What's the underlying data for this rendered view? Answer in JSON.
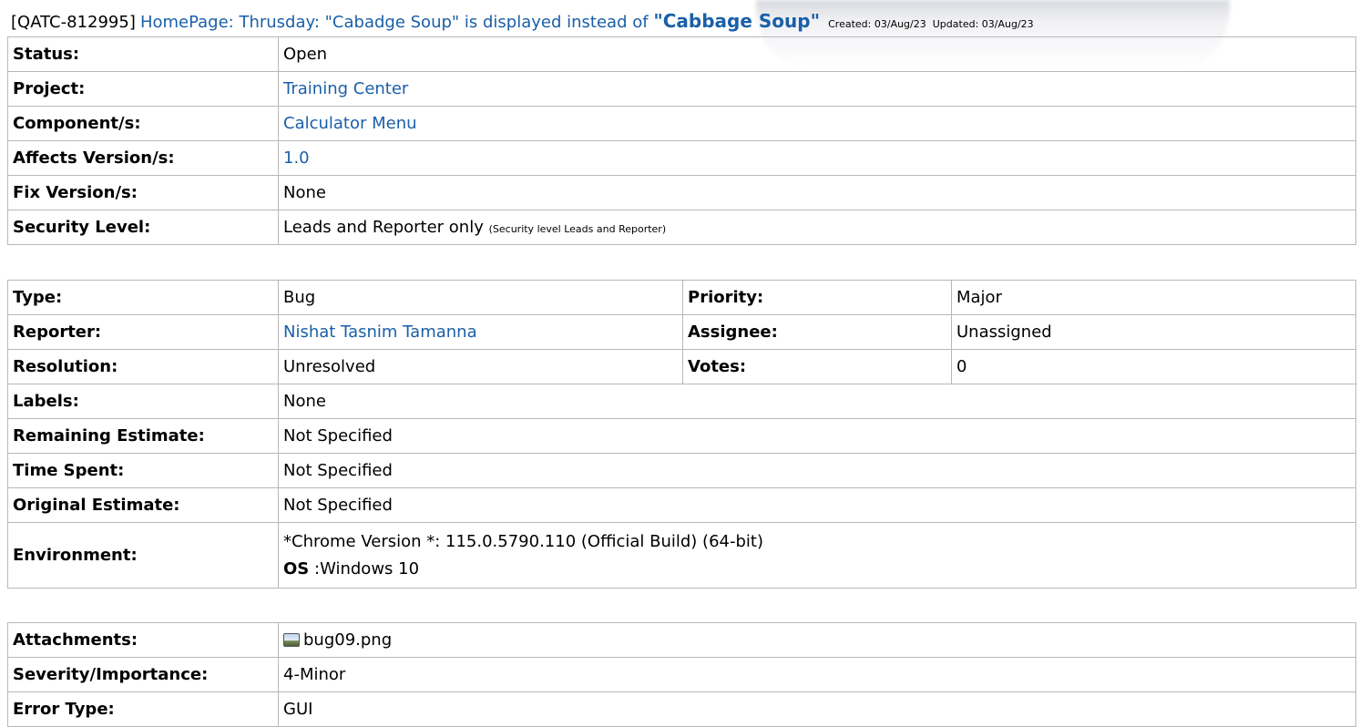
{
  "issue": {
    "key": "[QATC-812995]",
    "title": "HomePage: Thrusday: \"Cabadge Soup\" is displayed instead of",
    "title_end": "\"Cabbage Soup\"",
    "created_label": "Created:",
    "created": "03/Aug/23",
    "updated_label": "Updated:",
    "updated": "03/Aug/23"
  },
  "details": {
    "status_label": "Status:",
    "status": "Open",
    "project_label": "Project:",
    "project": "Training Center",
    "component_label": "Component/s:",
    "component": "Calculator Menu",
    "affects_label": "Affects Version/s:",
    "affects": "1.0",
    "fix_label": "Fix Version/s:",
    "fix": "None",
    "security_label": "Security Level:",
    "security": "Leads and Reporter only",
    "security_note": "(Security level Leads and Reporter)"
  },
  "people": {
    "type_label": "Type:",
    "type": "Bug",
    "priority_label": "Priority:",
    "priority": "Major",
    "reporter_label": "Reporter:",
    "reporter": "Nishat Tasnim Tamanna",
    "assignee_label": "Assignee:",
    "assignee": "Unassigned",
    "resolution_label": "Resolution:",
    "resolution": "Unresolved",
    "votes_label": "Votes:",
    "votes": "0",
    "labels_label": "Labels:",
    "labels": "None",
    "remaining_label": "Remaining Estimate:",
    "remaining": "Not Specified",
    "spent_label": "Time Spent:",
    "spent": "Not Specified",
    "original_label": "Original Estimate:",
    "original": "Not Specified",
    "environment_label": "Environment:",
    "environment_line1": "*Chrome Version *: 115.0.5790.110 (Official Build) (64-bit)",
    "environment_os_label": "OS",
    "environment_os": ":Windows 10"
  },
  "extra": {
    "attachments_label": "Attachments:",
    "attachment": "bug09.png",
    "attachment_icon": "image-file-icon",
    "severity_label": "Severity/Importance:",
    "severity": "4-Minor",
    "error_label": "Error Type:",
    "error": "GUI"
  }
}
